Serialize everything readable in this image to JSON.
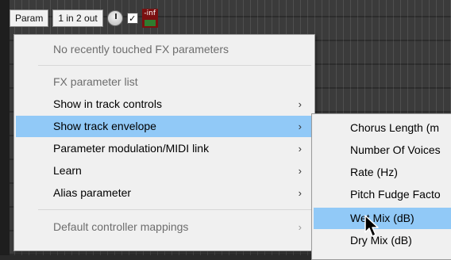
{
  "toolbar": {
    "param_label": "Param",
    "io_label": "1 in 2 out",
    "checkbox_glyph": "✓",
    "meter_label": "-inf"
  },
  "menu": {
    "items": [
      {
        "label": "No recently touched FX parameters",
        "disabled": true,
        "submenu": false
      },
      {
        "label": "FX parameter list",
        "disabled": true,
        "submenu": false
      },
      {
        "label": "Show in track controls",
        "disabled": false,
        "submenu": true
      },
      {
        "label": "Show track envelope",
        "disabled": false,
        "submenu": true,
        "highlighted": true
      },
      {
        "label": "Parameter modulation/MIDI link",
        "disabled": false,
        "submenu": true
      },
      {
        "label": "Learn",
        "disabled": false,
        "submenu": true
      },
      {
        "label": "Alias parameter",
        "disabled": false,
        "submenu": true
      },
      {
        "label": "Default controller mappings",
        "disabled": true,
        "submenu": true
      }
    ],
    "arrow_glyph": "›"
  },
  "submenu": {
    "items": [
      {
        "label": "Chorus Length (m"
      },
      {
        "label": "Number Of Voices"
      },
      {
        "label": "Rate (Hz)"
      },
      {
        "label": "Pitch Fudge Facto"
      },
      {
        "label": "Wet Mix (dB)",
        "highlighted": true
      },
      {
        "label": "Dry Mix (dB)"
      }
    ]
  },
  "colors": {
    "highlight": "#91c9f7",
    "menu_bg": "#f0f0f0",
    "meter_bg": "#7a1010"
  }
}
